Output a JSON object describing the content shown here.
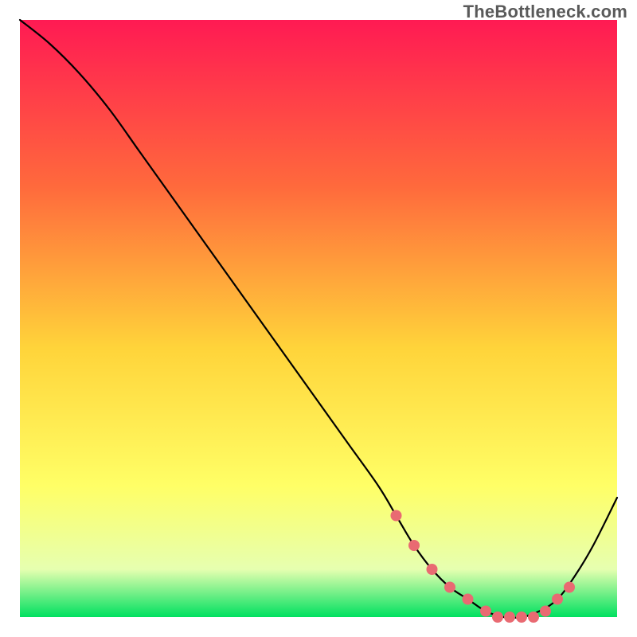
{
  "watermark": "TheBottleneck.com",
  "colors": {
    "gradient_top": "#ff1a53",
    "gradient_mid1": "#ff6a3c",
    "gradient_mid2": "#ffd43a",
    "gradient_mid3": "#ffff66",
    "gradient_mid4": "#e6ffb0",
    "gradient_bottom": "#00e060",
    "curve": "#000000",
    "dots": "#e96a72"
  },
  "chart_data": {
    "type": "line",
    "title": "",
    "xlabel": "",
    "ylabel": "",
    "xlim": [
      0,
      100
    ],
    "ylim": [
      0,
      100
    ],
    "series": [
      {
        "name": "bottleneck-curve",
        "x": [
          0,
          5,
          10,
          15,
          20,
          25,
          30,
          35,
          40,
          45,
          50,
          55,
          60,
          63,
          66,
          69,
          72,
          75,
          78,
          81,
          84,
          87,
          90,
          93,
          96,
          100
        ],
        "values": [
          100,
          96,
          91,
          85,
          78,
          71,
          64,
          57,
          50,
          43,
          36,
          29,
          22,
          17,
          12,
          8,
          5,
          3,
          1,
          0,
          0,
          1,
          3,
          7,
          12,
          20
        ]
      }
    ],
    "highlight_points": {
      "name": "optimal-range-dots",
      "x": [
        63,
        66,
        69,
        72,
        75,
        78,
        80,
        82,
        84,
        86,
        88,
        90,
        92
      ],
      "values": [
        17,
        12,
        8,
        5,
        3,
        1,
        0,
        0,
        0,
        0,
        1,
        3,
        5
      ]
    }
  }
}
